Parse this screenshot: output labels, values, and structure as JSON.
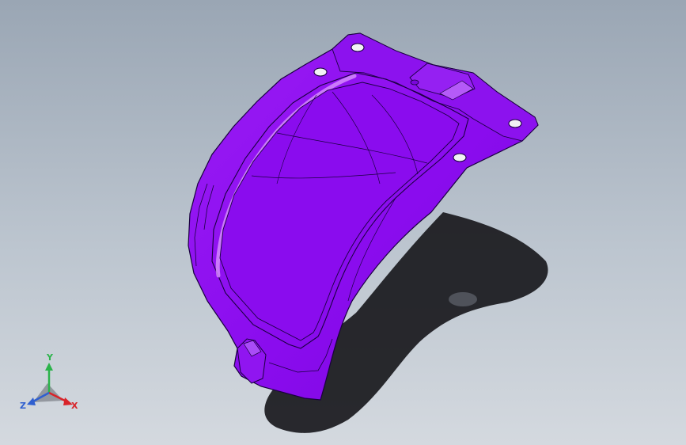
{
  "viewport": {
    "background_top": "#9aa6b4",
    "background_bottom": "#d4d9df"
  },
  "model": {
    "part_color": "#8b0fef",
    "highlight_color": "#c46cf9",
    "edge_color": "#1a0040",
    "shadow_color": "#1a1a1e",
    "mounting_holes": 5
  },
  "triad": {
    "x_label": "X",
    "y_label": "Y",
    "z_label": "Z",
    "x_color": "#d8242a",
    "y_color": "#2bb34a",
    "z_color": "#2f5fd0"
  }
}
